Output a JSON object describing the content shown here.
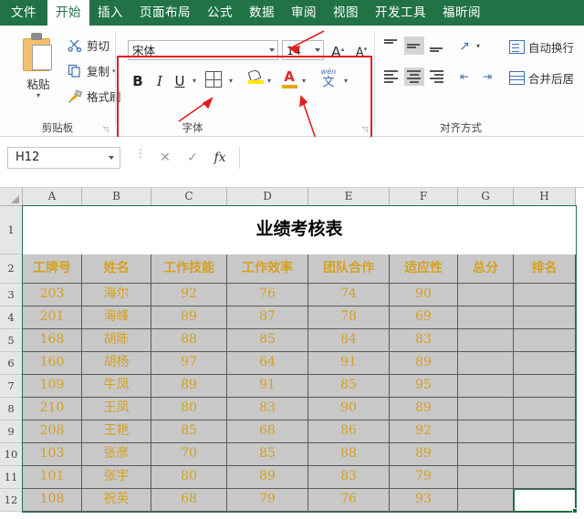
{
  "ribbon": {
    "tabs": [
      {
        "label": "文件",
        "active": false
      },
      {
        "label": "开始",
        "active": true
      },
      {
        "label": "插入",
        "active": false
      },
      {
        "label": "页面布局",
        "active": false
      },
      {
        "label": "公式",
        "active": false
      },
      {
        "label": "数据",
        "active": false
      },
      {
        "label": "审阅",
        "active": false
      },
      {
        "label": "视图",
        "active": false
      },
      {
        "label": "开发工具",
        "active": false
      },
      {
        "label": "福昕阅",
        "active": false
      }
    ],
    "clipboard": {
      "group_label": "剪贴板",
      "paste_label": "粘贴",
      "cut_label": "剪切",
      "copy_label": "复制",
      "format_painter_label": "格式刷"
    },
    "font": {
      "group_label": "字体",
      "font_name": "宋体",
      "font_size": "14",
      "bold_label": "B",
      "italic_label": "I",
      "underline_label": "U",
      "grow_font_label": "A",
      "shrink_font_label": "A",
      "phonetic_top": "wén",
      "phonetic_bottom": "文"
    },
    "alignment": {
      "group_label": "对齐方式",
      "wrap_text_label": "自动换行",
      "merge_center_label": "合并后居"
    },
    "annotation": {
      "highlight_color": "#e02020",
      "arrow_targets": [
        "font-size-box",
        "border-dropdown",
        "font-color-dropdown"
      ]
    }
  },
  "formula_bar": {
    "name_box_value": "H12",
    "cancel_icon": "✕",
    "enter_icon": "✓",
    "function_icon": "fx",
    "formula_value": ""
  },
  "sheet": {
    "columns": [
      "A",
      "B",
      "C",
      "D",
      "E",
      "F",
      "G",
      "H"
    ],
    "rows": [
      "1",
      "2",
      "3",
      "4",
      "5",
      "6",
      "7",
      "8",
      "9",
      "10",
      "11",
      "12"
    ],
    "title": "业绩考核表",
    "headers": [
      "工牌号",
      "姓名",
      "工作技能",
      "工作效率",
      "团队合作",
      "适应性",
      "总分",
      "排名"
    ],
    "data": [
      {
        "id": "203",
        "name": "海尔",
        "skill": "92",
        "efficiency": "76",
        "teamwork": "74",
        "adaptability": "90",
        "total": "",
        "rank": ""
      },
      {
        "id": "201",
        "name": "海峰",
        "skill": "89",
        "efficiency": "87",
        "teamwork": "78",
        "adaptability": "69",
        "total": "",
        "rank": ""
      },
      {
        "id": "168",
        "name": "胡陈",
        "skill": "88",
        "efficiency": "85",
        "teamwork": "84",
        "adaptability": "83",
        "total": "",
        "rank": ""
      },
      {
        "id": "160",
        "name": "胡杨",
        "skill": "97",
        "efficiency": "64",
        "teamwork": "91",
        "adaptability": "89",
        "total": "",
        "rank": ""
      },
      {
        "id": "109",
        "name": "牛凤",
        "skill": "89",
        "efficiency": "91",
        "teamwork": "85",
        "adaptability": "95",
        "total": "",
        "rank": ""
      },
      {
        "id": "210",
        "name": "王凤",
        "skill": "80",
        "efficiency": "83",
        "teamwork": "90",
        "adaptability": "89",
        "total": "",
        "rank": ""
      },
      {
        "id": "208",
        "name": "王艳",
        "skill": "85",
        "efficiency": "68",
        "teamwork": "86",
        "adaptability": "92",
        "total": "",
        "rank": ""
      },
      {
        "id": "103",
        "name": "张彦",
        "skill": "70",
        "efficiency": "85",
        "teamwork": "88",
        "adaptability": "89",
        "total": "",
        "rank": ""
      },
      {
        "id": "101",
        "name": "张宇",
        "skill": "80",
        "efficiency": "89",
        "teamwork": "83",
        "adaptability": "79",
        "total": "",
        "rank": ""
      },
      {
        "id": "108",
        "name": "祝英",
        "skill": "68",
        "efficiency": "79",
        "teamwork": "76",
        "adaptability": "93",
        "total": "",
        "rank": ""
      }
    ],
    "active_cell": "H12",
    "selection_color": "#217346",
    "data_text_color": "#d5a021",
    "data_fill_color": "#c8c8c8"
  }
}
